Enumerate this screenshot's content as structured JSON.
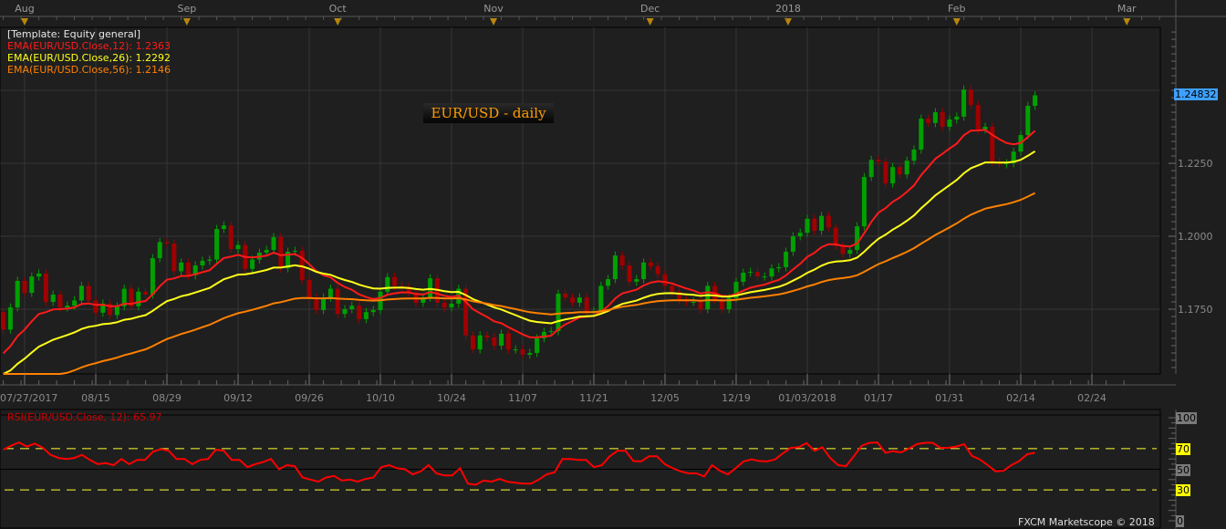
{
  "template_label": "[Template: Equity general]",
  "legend": [
    {
      "text": "EMA(EUR/USD.Close,12): 1.2363",
      "color": "#ff1a1a"
    },
    {
      "text": "EMA(EUR/USD.Close,26): 1.2292",
      "color": "#ffff1a"
    },
    {
      "text": "EMA(EUR/USD.Close,56): 1.2146",
      "color": "#ff8000"
    }
  ],
  "title": "EUR/USD - daily",
  "current_price": "1.24832",
  "rsi_label": "RSI(EUR/USD.Close, 12): 65.97",
  "footer": "FXCM Marketscope © 2018",
  "colors": {
    "up": "#00a000",
    "down": "#a00000",
    "ema12": "#ff1a1a",
    "ema26": "#ffff1a",
    "ema56": "#ff8000",
    "rsi": "#ff0000",
    "badge": "#3fa0ff"
  },
  "chart_data": {
    "type": "candlestick",
    "title": "EUR/USD - daily",
    "ylim": [
      1.1528,
      1.2716
    ],
    "y_ticks": [
      "1.1750",
      "1.2000",
      "1.2250"
    ],
    "y_tick_values": [
      1.175,
      1.2,
      1.225
    ],
    "first_open": 1.174,
    "closes": [
      1.168,
      1.1756,
      1.1847,
      1.1806,
      1.1862,
      1.1872,
      1.1775,
      1.18,
      1.1756,
      1.1762,
      1.178,
      1.183,
      1.178,
      1.1738,
      1.1769,
      1.173,
      1.176,
      1.182,
      1.176,
      1.181,
      1.18,
      1.1925,
      1.198,
      1.1975,
      1.188,
      1.191,
      1.1866,
      1.19,
      1.1916,
      1.192,
      1.2025,
      1.2037,
      1.1956,
      1.197,
      1.1888,
      1.192,
      1.1944,
      1.1953,
      1.1997,
      1.189,
      1.1947,
      1.195,
      1.185,
      1.179,
      1.1747,
      1.179,
      1.182,
      1.1734,
      1.175,
      1.1762,
      1.1716,
      1.174,
      1.1747,
      1.181,
      1.186,
      1.183,
      1.1828,
      1.1806,
      1.1772,
      1.179,
      1.1856,
      1.1772,
      1.1756,
      1.1769,
      1.182,
      1.166,
      1.1612,
      1.166,
      1.1653,
      1.1625,
      1.1666,
      1.1612,
      1.1612,
      1.1594,
      1.16,
      1.165,
      1.1672,
      1.1675,
      1.1803,
      1.179,
      1.1772,
      1.179,
      1.1738,
      1.1744,
      1.183,
      1.1853,
      1.1934,
      1.19,
      1.1844,
      1.1853,
      1.191,
      1.1897,
      1.187,
      1.183,
      1.181,
      1.178,
      1.1775,
      1.1775,
      1.175,
      1.183,
      1.1784,
      1.175,
      1.1788,
      1.1844,
      1.1875,
      1.1878,
      1.1862,
      1.1862,
      1.189,
      1.1894,
      1.1947,
      1.2,
      1.2012,
      1.206,
      1.2019,
      1.207,
      1.203,
      1.1966,
      1.194,
      1.1953,
      1.2034,
      1.2203,
      1.2262,
      1.2256,
      1.2181,
      1.2237,
      1.2212,
      1.2259,
      1.2297,
      1.2403,
      1.2388,
      1.2425,
      1.2375,
      1.24,
      1.241,
      1.2503,
      1.245,
      1.2366,
      1.2375,
      1.2256,
      1.2247,
      1.225,
      1.229,
      1.2347,
      1.2447,
      1.2483
    ],
    "ema_seeds": {
      "ema12": 1.1584,
      "ema26": 1.151,
      "ema56": 1.142
    },
    "ema_periods": [
      12,
      26,
      56
    ],
    "date_ticks": [
      {
        "label": "07/27/2017",
        "index": 3
      },
      {
        "label": "08/15",
        "index": 13
      },
      {
        "label": "08/29",
        "index": 23
      },
      {
        "label": "09/12",
        "index": 33
      },
      {
        "label": "09/26",
        "index": 43
      },
      {
        "label": "10/10",
        "index": 53
      },
      {
        "label": "10/24",
        "index": 63
      },
      {
        "label": "11/07",
        "index": 73
      },
      {
        "label": "11/21",
        "index": 83
      },
      {
        "label": "12/05",
        "index": 93
      },
      {
        "label": "12/19",
        "index": 103
      },
      {
        "label": "01/03/2018",
        "index": 113
      },
      {
        "label": "01/17",
        "index": 123
      },
      {
        "label": "01/31",
        "index": 133
      },
      {
        "label": "02/14",
        "index": 143
      },
      {
        "label": "02/24",
        "index": 153
      }
    ],
    "month_ticks": [
      {
        "label": "Aug",
        "index": 3
      },
      {
        "label": "Sep",
        "index": 25.8
      },
      {
        "label": "Oct",
        "index": 47
      },
      {
        "label": "Nov",
        "index": 68.9
      },
      {
        "label": "Dec",
        "index": 90.9
      },
      {
        "label": "2018",
        "index": 110.3
      },
      {
        "label": "Feb",
        "index": 134
      },
      {
        "label": "Mar",
        "index": 157.9
      }
    ],
    "rsi": {
      "period": 12,
      "ylim": [
        0,
        100
      ],
      "levels": [
        30,
        70
      ],
      "axis_ticks": [
        {
          "label": "100",
          "value": 100,
          "style": "gray"
        },
        {
          "label": "70",
          "value": 70,
          "style": "yellow"
        },
        {
          "label": "50",
          "value": 50,
          "style": "gray"
        },
        {
          "label": "30",
          "value": 30,
          "style": "yellow"
        },
        {
          "label": "0",
          "value": 0,
          "style": "gray"
        }
      ],
      "values": [
        69,
        72.8,
        76,
        72,
        75,
        71,
        64,
        61,
        60,
        61,
        64,
        59,
        55,
        56,
        54,
        60,
        55,
        59,
        59,
        67,
        69.6,
        68,
        60,
        60,
        55,
        59,
        60,
        69,
        68,
        59,
        59,
        52,
        55,
        57,
        60,
        50,
        54,
        53,
        42,
        40,
        38,
        42,
        43.5,
        39,
        40,
        38,
        40.6,
        42,
        52,
        54,
        51,
        50,
        45,
        48,
        54,
        46,
        44,
        44,
        51,
        36,
        35,
        39,
        38,
        40.6,
        38,
        37,
        36,
        36,
        40,
        45,
        47,
        60,
        60,
        59,
        59,
        52,
        54,
        62.6,
        68,
        68,
        58,
        57.6,
        62.6,
        62.6,
        55,
        51,
        48,
        46,
        46,
        43,
        54,
        48.5,
        45,
        51,
        57.6,
        59.6,
        58,
        57.6,
        59.6,
        65.5,
        70.8,
        71.3,
        75.4,
        68,
        71.3,
        61,
        54,
        53,
        62.6,
        72.8,
        75.7,
        76,
        66,
        67.5,
        66.4,
        70,
        74.3,
        75.7,
        75.7,
        70.8,
        70.8,
        72,
        74.3,
        63,
        59.6,
        54,
        48,
        48.5,
        54,
        58,
        64.6,
        66
      ]
    }
  }
}
